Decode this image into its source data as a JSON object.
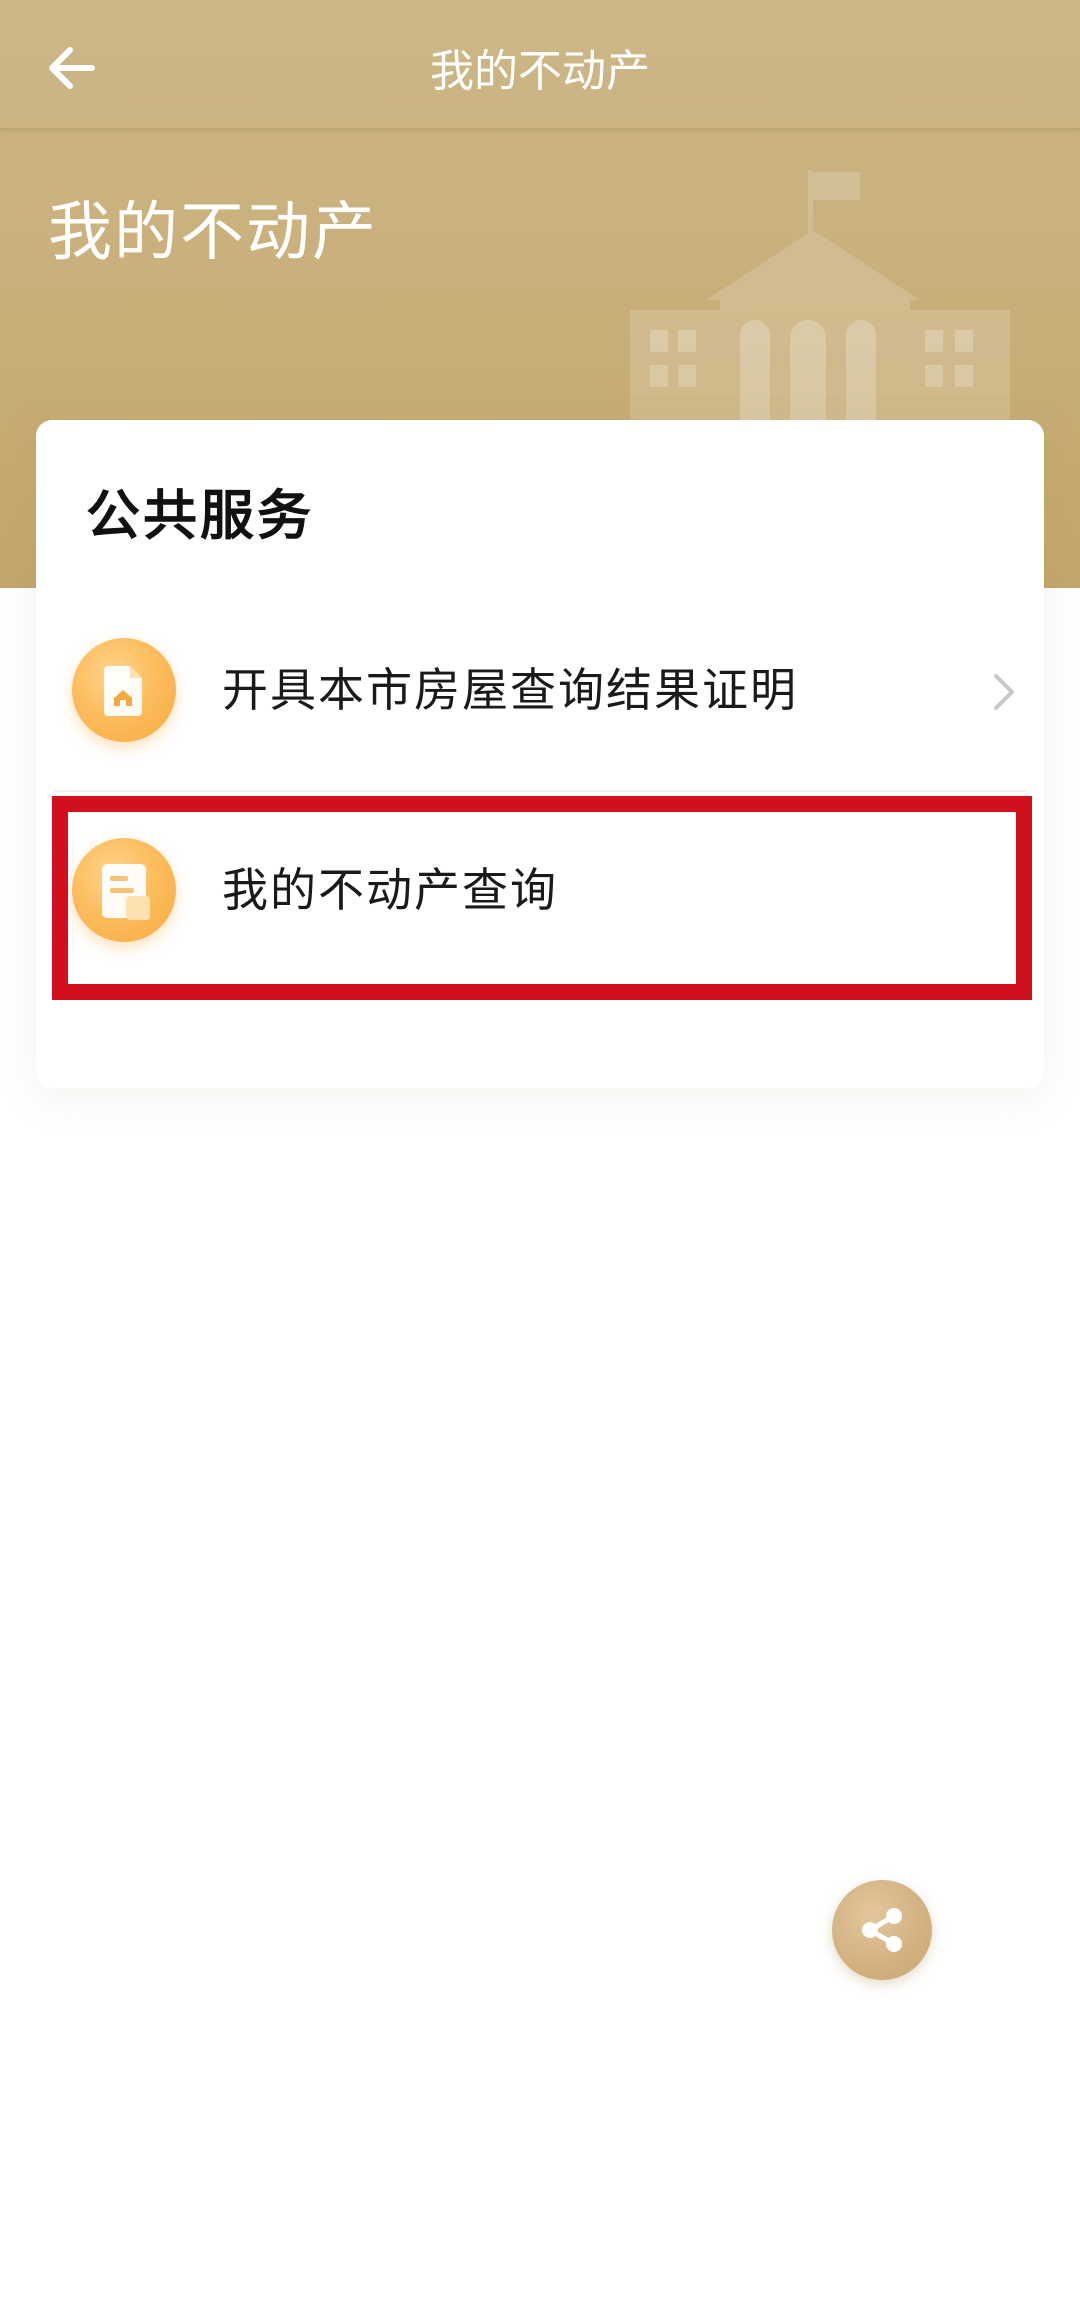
{
  "header": {
    "title": "我的不动产",
    "back_icon": "arrow-left-icon"
  },
  "hero": {
    "title": "我的不动产",
    "illustration": "government-building-icon"
  },
  "card": {
    "title": "公共服务",
    "items": [
      {
        "label": "开具本市房屋查询结果证明",
        "icon": "house-document-icon",
        "has_chevron": true
      },
      {
        "label": "我的不动产查询",
        "icon": "document-list-icon",
        "has_chevron": false,
        "highlighted": true
      }
    ]
  },
  "share": {
    "icon": "share-icon"
  },
  "colors": {
    "hero_gold": "#c9b07c",
    "icon_orange": "#fdbd5f",
    "highlight_red": "#d0101d",
    "share_gold": "#d4b283"
  }
}
